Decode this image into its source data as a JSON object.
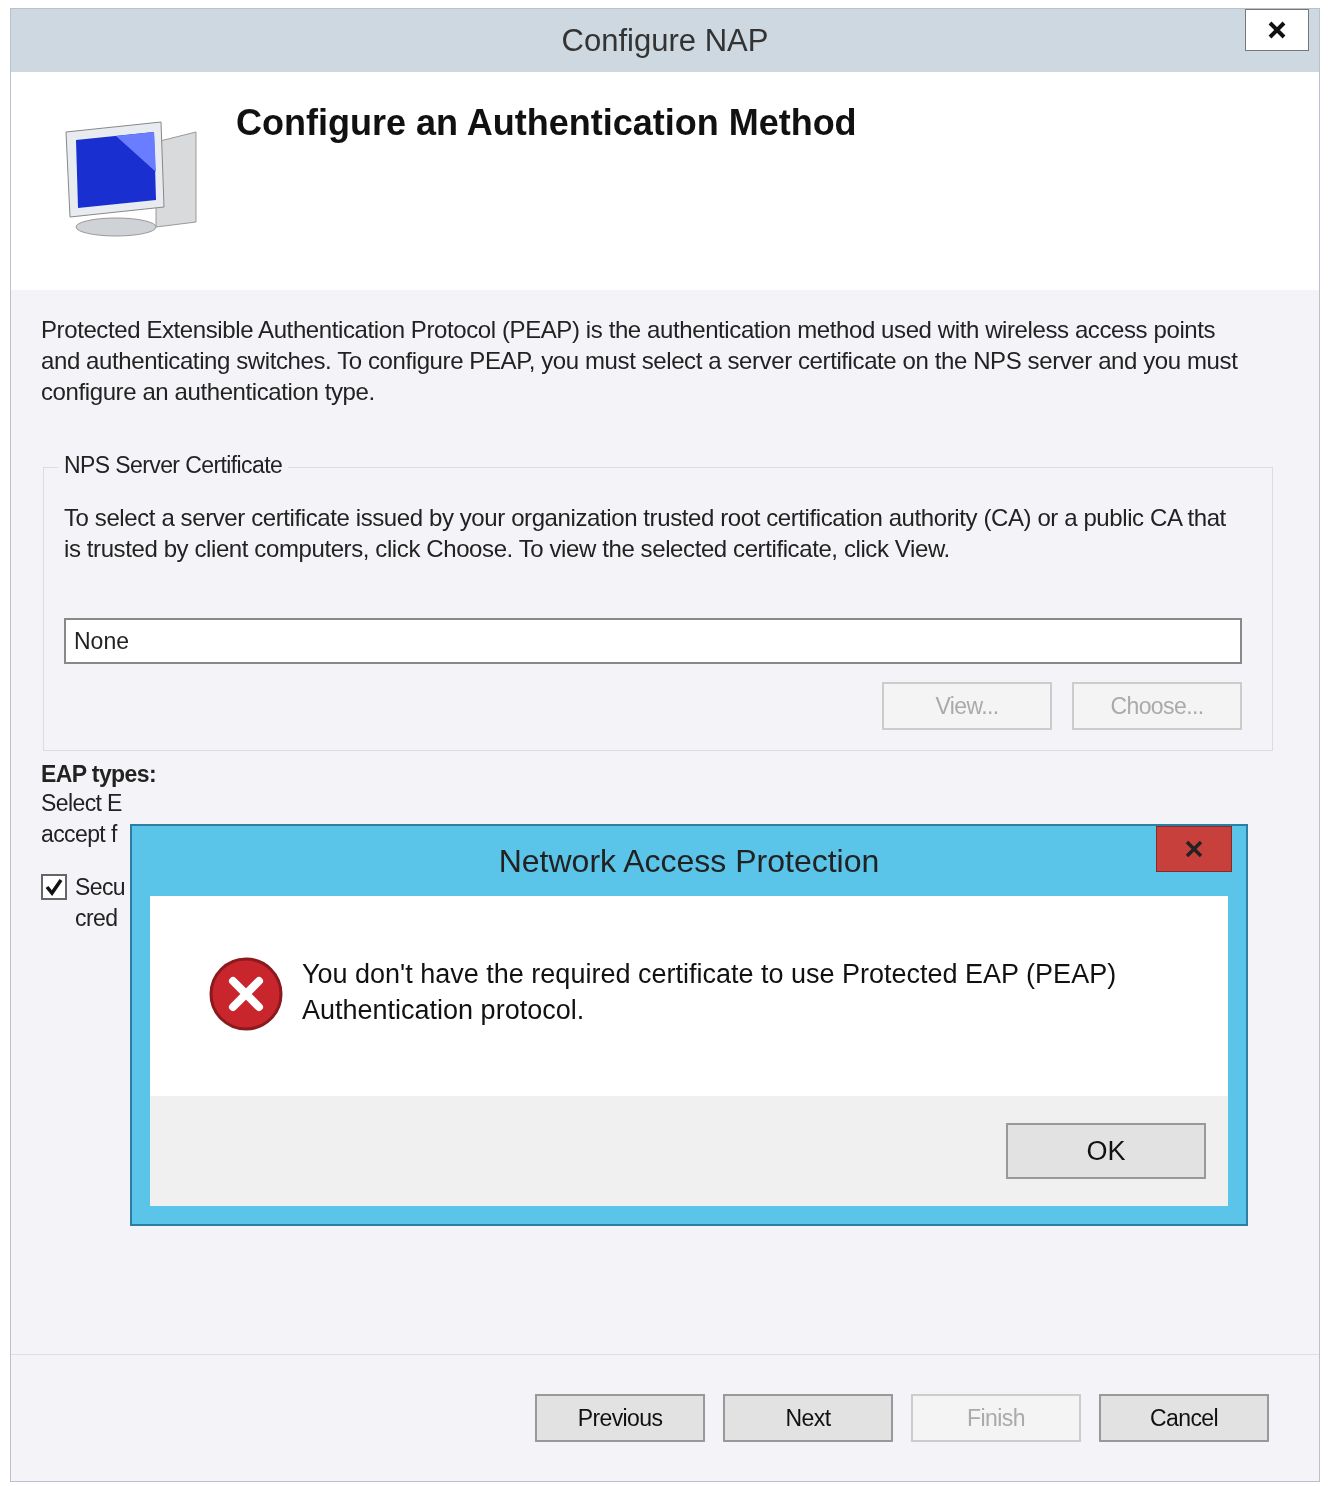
{
  "window": {
    "title": "Configure NAP"
  },
  "header": {
    "title": "Configure an Authentication Method"
  },
  "description": "Protected Extensible Authentication Protocol (PEAP) is the authentication method used with wireless access points and authenticating switches. To configure PEAP, you must select a server certificate on the NPS server and you must configure an authentication type.",
  "certificate_group": {
    "title": "NPS Server Certificate",
    "text": "To select a server certificate issued by your organization trusted root certification authority (CA) or a public CA that is trusted by client computers, click Choose. To view the selected certificate, click View.",
    "field": {
      "value": "None"
    },
    "buttons": [
      {
        "label": "View...",
        "disabled": true
      },
      {
        "label": "Choose...",
        "disabled": true
      }
    ]
  },
  "eap": {
    "title": "EAP types:",
    "lines": [
      "Select E",
      "accept f"
    ],
    "checkbox": {
      "lines": [
        "Secu",
        "cred"
      ],
      "checked": true
    }
  },
  "buttons": [
    {
      "label": "Previous",
      "disabled": false
    },
    {
      "label": "Next",
      "disabled": false
    },
    {
      "label": "Finish",
      "disabled": true
    },
    {
      "label": "Cancel",
      "disabled": false
    }
  ],
  "dialog": {
    "title": "Network Access Protection",
    "message": "You don't have the required certificate to use Protected EAP (PEAP) Authentication protocol.",
    "buttons": [
      {
        "label": "OK"
      }
    ]
  }
}
